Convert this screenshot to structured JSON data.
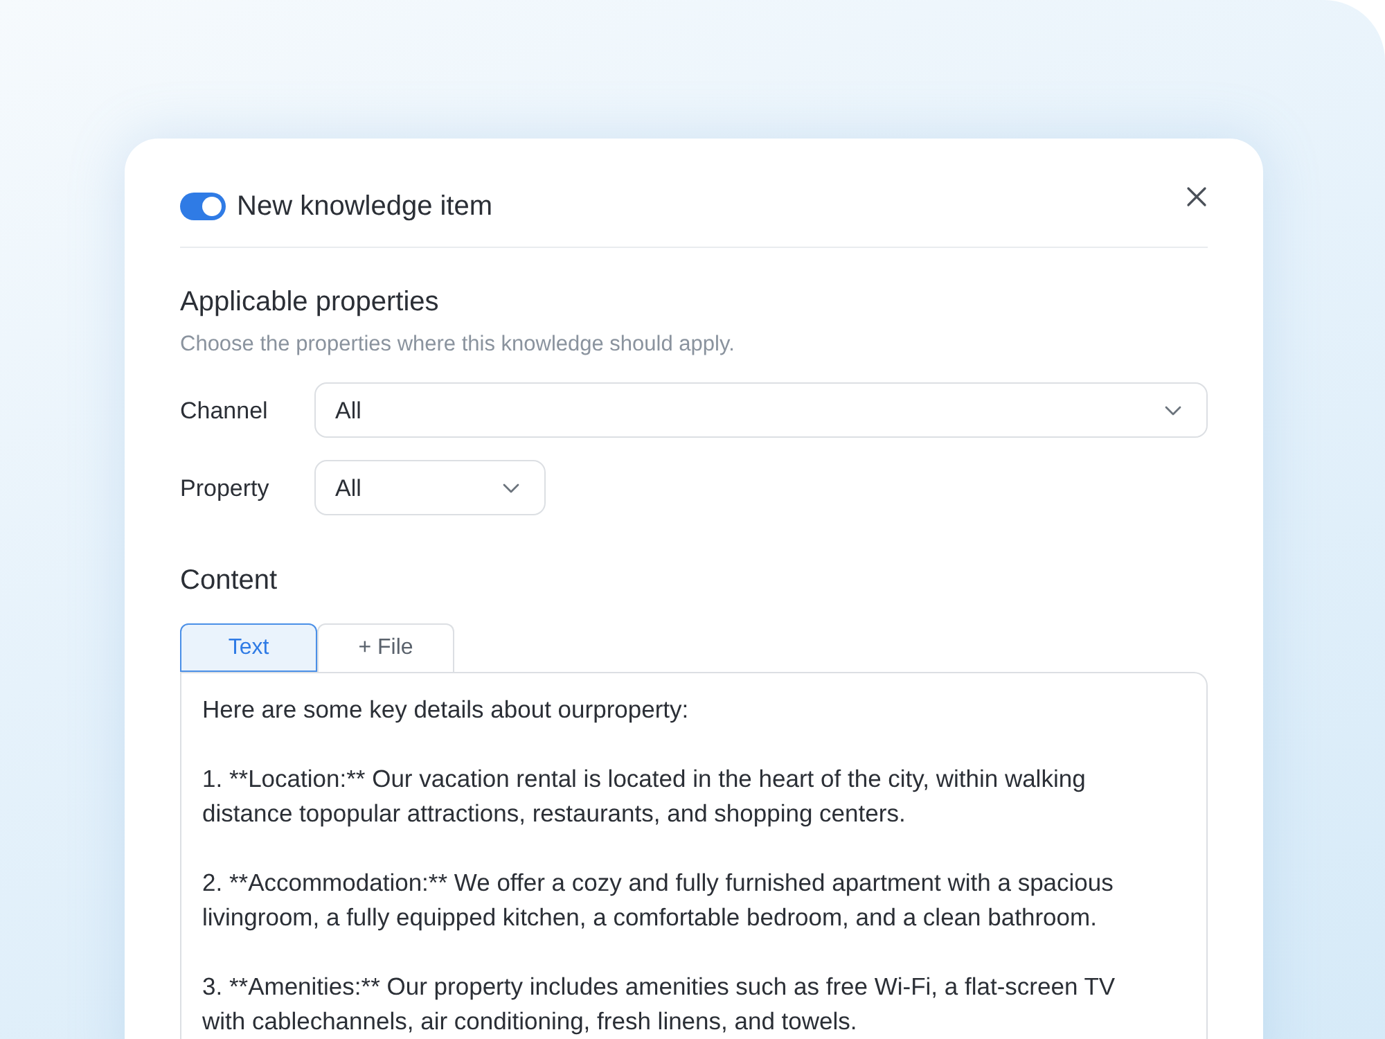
{
  "dialog": {
    "enabled": true,
    "title": "New knowledge item"
  },
  "properties_section": {
    "heading": "Applicable properties",
    "description": "Choose the properties where this knowledge should apply.",
    "fields": [
      {
        "label": "Channel",
        "value": "All",
        "wide": true
      },
      {
        "label": "Property",
        "value": "All",
        "wide": false
      }
    ]
  },
  "content_section": {
    "heading": "Content",
    "tabs": [
      {
        "label": "Text",
        "selected": true
      },
      {
        "label": "+ File",
        "selected": false
      }
    ],
    "text_paragraphs": [
      [
        "Here are some key details about ourproperty:"
      ],
      [
        "1. **Location:** Our vacation rental is located in the heart of the city, within walking",
        "distance topopular attractions, restaurants, and shopping centers."
      ],
      [
        "2. **Accommodation:** We offer a cozy and fully furnished apartment with a spacious",
        "livingroom, a fully equipped kitchen, a comfortable bedroom, and a clean bathroom."
      ],
      [
        "3. **Amenities:** Our property includes amenities such as free Wi-Fi, a flat-screen TV",
        "with cablechannels, air conditioning, fresh linens, and towels."
      ]
    ]
  }
}
